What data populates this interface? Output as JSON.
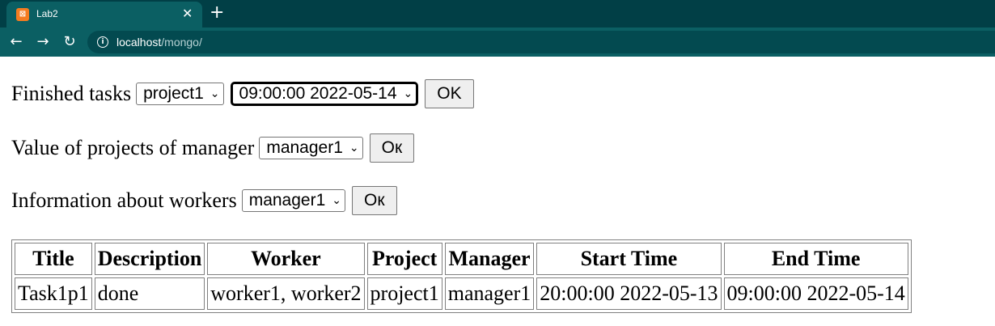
{
  "browser": {
    "tab_title": "Lab2",
    "tab_close": "✕",
    "new_tab": "+",
    "url_host": "localhost",
    "url_path": "/mongo/"
  },
  "forms": {
    "finished_tasks": {
      "label": "Finished tasks",
      "project_select": "project1",
      "time_select": "09:00:00 2022-05-14",
      "button": "OK"
    },
    "value_of_projects": {
      "label": "Value of projects of manager",
      "manager_select": "manager1",
      "button": "Ок"
    },
    "information_workers": {
      "label": "Information about workers",
      "manager_select": "manager1",
      "button": "Ок"
    }
  },
  "table": {
    "headers": [
      "Title",
      "Description",
      "Worker",
      "Project",
      "Manager",
      "Start Time",
      "End Time"
    ],
    "rows": [
      [
        "Task1p1",
        "done",
        "worker1, worker2",
        "project1",
        "manager1",
        "20:00:00 2022-05-13",
        "09:00:00 2022-05-14"
      ]
    ]
  }
}
